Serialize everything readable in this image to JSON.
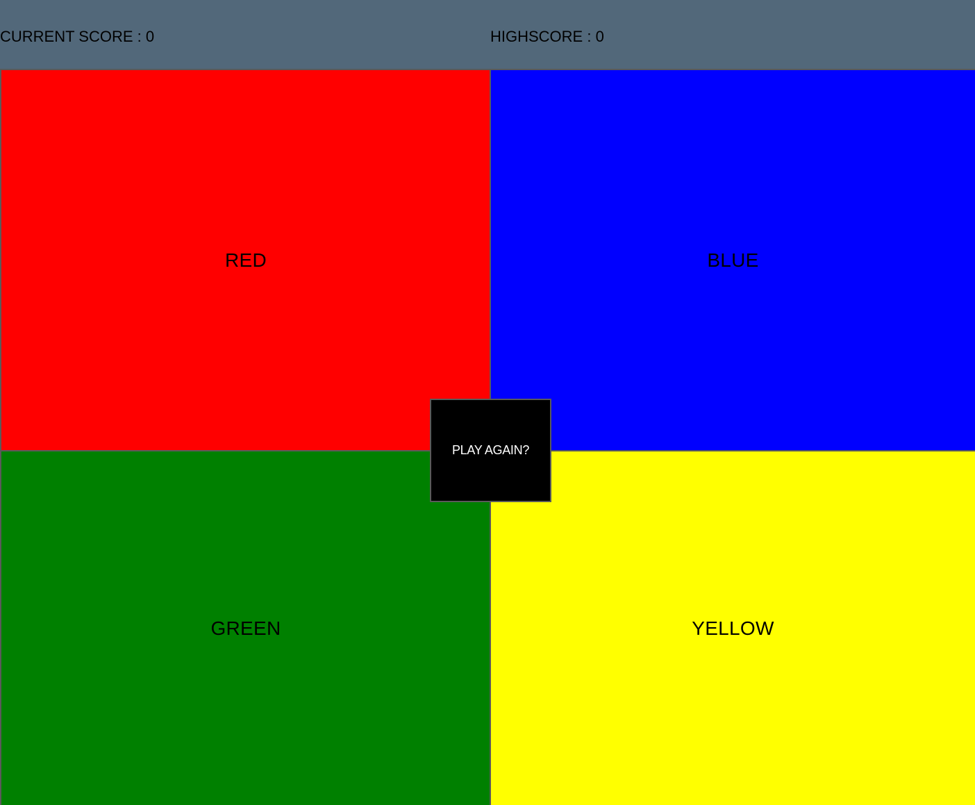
{
  "header": {
    "current_score_label": "CURRENT SCORE : 0",
    "highscore_label": "HIGHSCORE : 0"
  },
  "tiles": [
    {
      "label": "RED",
      "color": "#ff0000"
    },
    {
      "label": "BLUE",
      "color": "#0000ff"
    },
    {
      "label": "GREEN",
      "color": "#008000"
    },
    {
      "label": "YELLOW",
      "color": "#ffff00"
    }
  ],
  "play_again": {
    "label": "PLAY AGAIN?"
  },
  "colors": {
    "header_bg": "#52687a",
    "button_bg": "#000000",
    "button_text": "#ffffff"
  }
}
